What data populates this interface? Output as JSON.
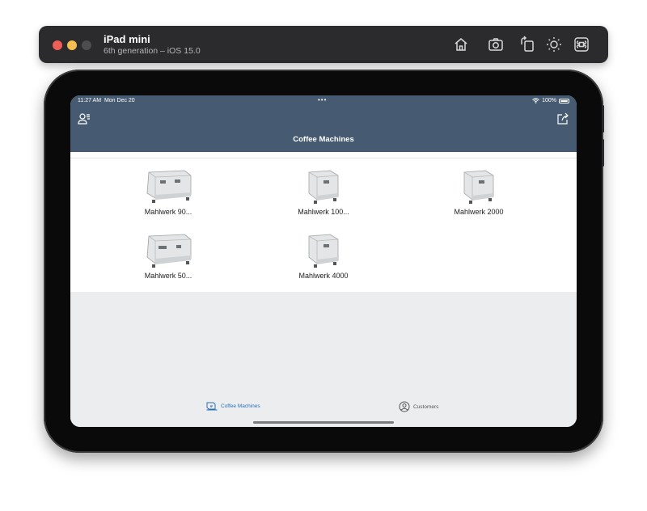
{
  "simulator": {
    "device_name": "iPad mini",
    "device_detail": "6th generation – iOS 15.0",
    "tools": [
      "home-icon",
      "screenshot-icon",
      "rotate-icon",
      "appearance-icon",
      "command-icon"
    ]
  },
  "status_bar": {
    "time": "11:27 AM",
    "date": "Mon Dec 20",
    "dots": "•••",
    "battery": "100%"
  },
  "nav": {
    "title": "Coffee Machines",
    "left_icon": "user-list-icon",
    "right_icon": "share-icon"
  },
  "machines": [
    {
      "label": "Mahlwerk 90..."
    },
    {
      "label": "Mahlwerk 100..."
    },
    {
      "label": "Mahlwerk 2000"
    },
    {
      "label": "Mahlwerk 50..."
    },
    {
      "label": "Mahlwerk 4000"
    }
  ],
  "tabs": [
    {
      "label": "Coffee Machines",
      "icon": "coffee-machine-icon",
      "active": true
    },
    {
      "label": "Customers",
      "icon": "person-circle-icon",
      "active": false
    }
  ],
  "colors": {
    "nav_background": "#465b71",
    "active_tab": "#2f6fb8",
    "inactive_tab": "#555555"
  }
}
